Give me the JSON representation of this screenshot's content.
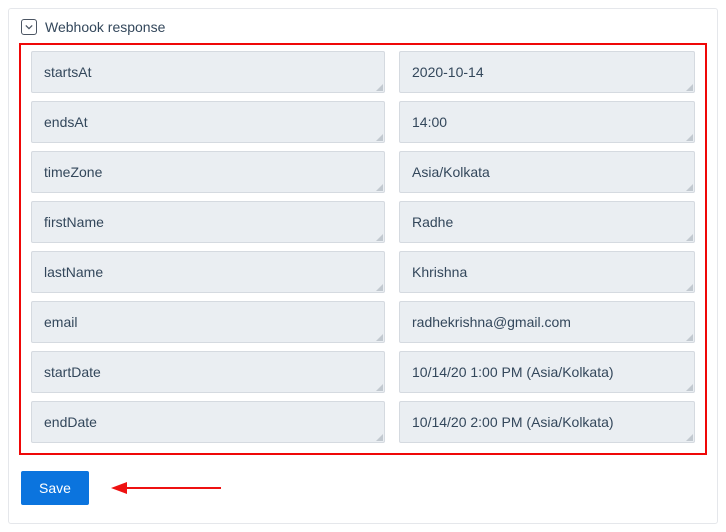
{
  "section": {
    "title": "Webhook response"
  },
  "rows": [
    {
      "key": "startsAt",
      "value": "2020-10-14"
    },
    {
      "key": "endsAt",
      "value": "14:00"
    },
    {
      "key": "timeZone",
      "value": "Asia/Kolkata"
    },
    {
      "key": "firstName",
      "value": "Radhe"
    },
    {
      "key": "lastName",
      "value": "Khrishna"
    },
    {
      "key": "email",
      "value": "radhekrishna@gmail.com"
    },
    {
      "key": "startDate",
      "value": "10/14/20 1:00 PM (Asia/Kolkata)"
    },
    {
      "key": "endDate",
      "value": "10/14/20 2:00 PM (Asia/Kolkata)"
    }
  ],
  "actions": {
    "save_label": "Save"
  }
}
